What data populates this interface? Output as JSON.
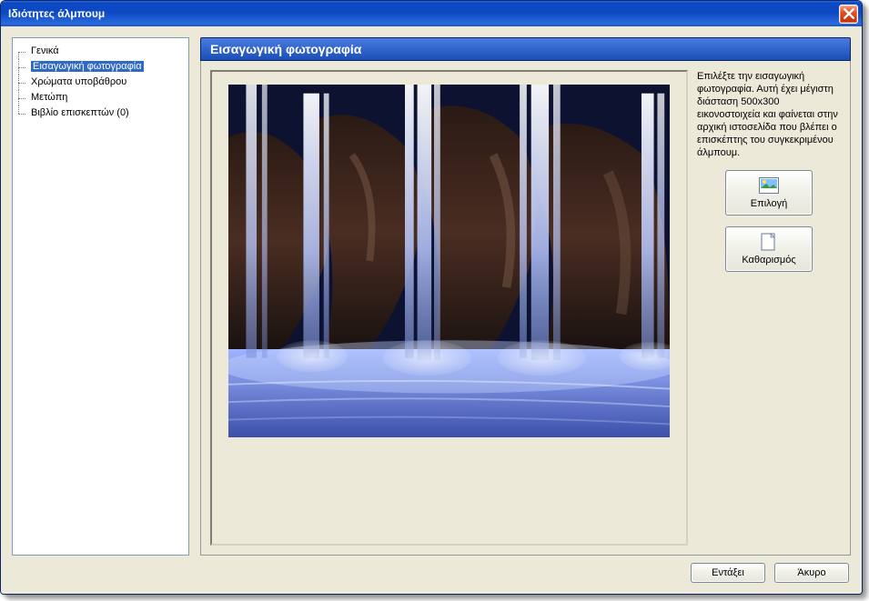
{
  "window": {
    "title": "Ιδιότητες άλμπουμ"
  },
  "nav": {
    "items": [
      {
        "label": "Γενικά"
      },
      {
        "label": "Εισαγωγική φωτογραφία"
      },
      {
        "label": "Χρώματα υποβάθρου"
      },
      {
        "label": "Μετώπη"
      },
      {
        "label": "Βιβλίο επισκεπτών (0)"
      }
    ],
    "selectedIndex": 1
  },
  "panel": {
    "heading": "Εισαγωγική φωτογραφία",
    "help_text": "Επιλέξτε την εισαγωγική φωτογραφία. Αυτή έχει μέγιστη διάσταση 500x300 εικονοστοιχεία και φαίνεται στην αρχική ιστοσελίδα που βλέπει ο επισκέπτης του συγκεκριμένου άλμπουμ."
  },
  "buttons": {
    "select": "Επιλογή",
    "clear": "Καθαρισμός",
    "ok": "Εντάξει",
    "cancel": "Άκυρο"
  },
  "icons": {
    "select": "image-icon",
    "clear": "blank-page-icon",
    "close": "close-icon"
  }
}
